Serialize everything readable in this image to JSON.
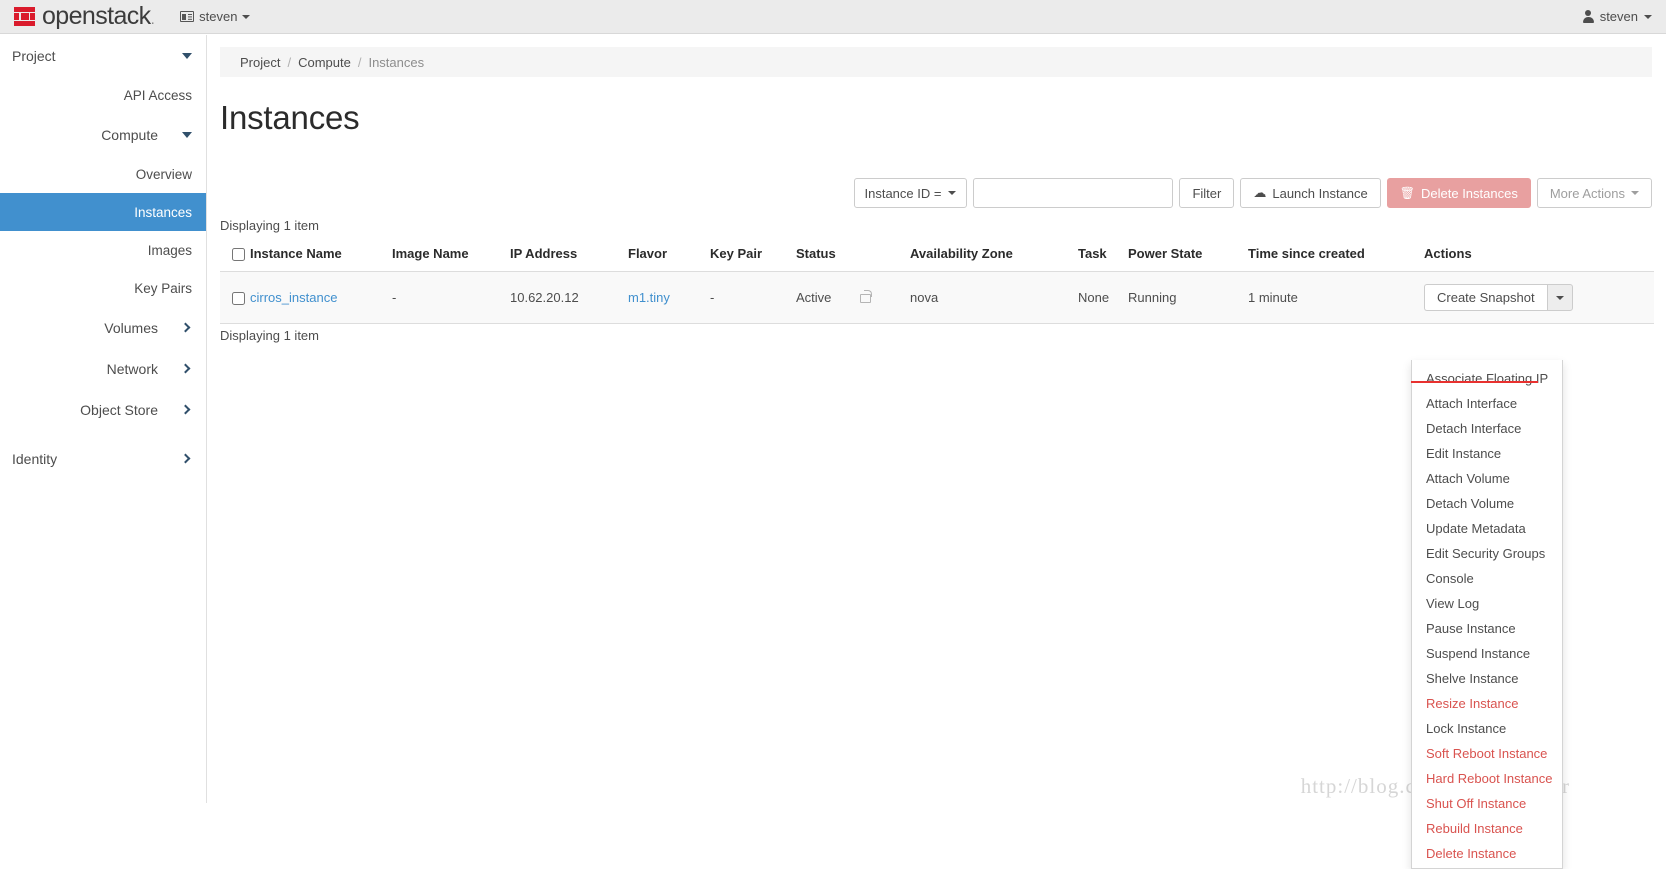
{
  "brand": {
    "name": "openstack",
    "tld": ".",
    "logo_icon": "openstack-logo-icon",
    "accent_color": "#da1b2c"
  },
  "topbar": {
    "project_switcher": {
      "icon": "project-box-icon",
      "label": "steven",
      "caret_icon": "caret-down-icon"
    },
    "user_menu": {
      "icon": "person-icon",
      "label": "steven",
      "caret_icon": "caret-down-icon"
    }
  },
  "sidebar": {
    "sections": [
      {
        "label": "Project",
        "icon": "chevron-down-icon",
        "expanded": true
      },
      {
        "label": "API Access",
        "type": "sub"
      },
      {
        "label": "Compute",
        "icon": "chevron-down-icon",
        "expanded": true,
        "type": "group"
      },
      {
        "label": "Overview",
        "type": "sub"
      },
      {
        "label": "Instances",
        "type": "sub",
        "active": true
      },
      {
        "label": "Images",
        "type": "sub"
      },
      {
        "label": "Key Pairs",
        "type": "sub"
      },
      {
        "label": "Volumes",
        "icon": "chevron-right-icon",
        "type": "group"
      },
      {
        "label": "Network",
        "icon": "chevron-right-icon",
        "type": "group"
      },
      {
        "label": "Object Store",
        "icon": "chevron-right-icon",
        "type": "group"
      },
      {
        "label": "Identity",
        "icon": "chevron-right-icon",
        "type": "section"
      }
    ],
    "active_color": "#4190ce"
  },
  "breadcrumb": {
    "items": [
      "Project",
      "Compute",
      "Instances"
    ],
    "separator": "/"
  },
  "page": {
    "title": "Instances"
  },
  "toolbar": {
    "filter_select_label": "Instance ID =",
    "filter_select_caret": "caret-down-icon",
    "filter_input_value": "",
    "filter_input_placeholder": "",
    "filter_button": "Filter",
    "launch_button": "Launch Instance",
    "launch_icon": "cloud-upload-icon",
    "delete_button": "Delete Instances",
    "delete_icon": "trash-icon",
    "delete_color": "#e8a0a0",
    "more_actions_button": "More Actions",
    "more_actions_caret": "caret-down-icon",
    "more_actions_disabled": true
  },
  "table": {
    "count_top": "Displaying 1 item",
    "count_bottom": "Displaying 1 item",
    "select_all_icon": "checkbox-icon",
    "headers": [
      "Instance Name",
      "Image Name",
      "IP Address",
      "Flavor",
      "Key Pair",
      "Status",
      "",
      "Availability Zone",
      "Task",
      "Power State",
      "Time since created",
      "Actions"
    ],
    "rows": [
      {
        "checkbox_icon": "checkbox-icon",
        "instance_name": "cirros_instance",
        "image_name": "-",
        "ip_address": "10.62.20.12",
        "flavor": "m1.tiny",
        "key_pair": "-",
        "status": "Active",
        "lock_icon": "lock-open-icon",
        "availability_zone": "nova",
        "task": "None",
        "power_state": "Running",
        "time_since_created": "1 minute",
        "action_label": "Create Snapshot",
        "action_caret": "caret-down-icon"
      }
    ]
  },
  "dropdown": {
    "open": true,
    "highlight_color": "#e8312f",
    "items": [
      {
        "label": "Associate Floating IP",
        "destructive": false,
        "underlined": true
      },
      {
        "label": "Attach Interface",
        "destructive": false
      },
      {
        "label": "Detach Interface",
        "destructive": false
      },
      {
        "label": "Edit Instance",
        "destructive": false
      },
      {
        "label": "Attach Volume",
        "destructive": false
      },
      {
        "label": "Detach Volume",
        "destructive": false
      },
      {
        "label": "Update Metadata",
        "destructive": false
      },
      {
        "label": "Edit Security Groups",
        "destructive": false
      },
      {
        "label": "Console",
        "destructive": false
      },
      {
        "label": "View Log",
        "destructive": false
      },
      {
        "label": "Pause Instance",
        "destructive": false
      },
      {
        "label": "Suspend Instance",
        "destructive": false
      },
      {
        "label": "Shelve Instance",
        "destructive": false
      },
      {
        "label": "Resize Instance",
        "destructive": true
      },
      {
        "label": "Lock Instance",
        "destructive": false
      },
      {
        "label": "Soft Reboot Instance",
        "destructive": true
      },
      {
        "label": "Hard Reboot Instance",
        "destructive": true
      },
      {
        "label": "Shut Off Instance",
        "destructive": true
      },
      {
        "label": "Rebuild Instance",
        "destructive": true
      },
      {
        "label": "Delete Instance",
        "destructive": true
      }
    ]
  },
  "watermark": {
    "text": "http://blog.csdn.net/songqier"
  }
}
